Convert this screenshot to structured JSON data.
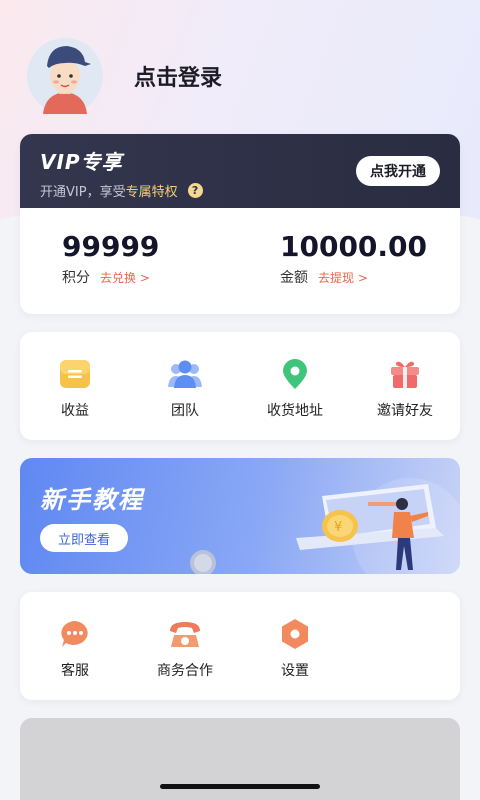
{
  "header": {
    "login_text": "点击登录"
  },
  "vip": {
    "title": "VIP专享",
    "subtitle_prefix": "开通VIP，享受",
    "subtitle_highlight": "专属特权",
    "help_icon": "?",
    "button": "点我开通"
  },
  "stats": [
    {
      "value": "99999",
      "label": "积分",
      "link": "去兑换 >"
    },
    {
      "value": "10000.00",
      "label": "金额",
      "link": "去提现 >"
    }
  ],
  "menu": [
    {
      "label": "收益",
      "icon": "income-icon"
    },
    {
      "label": "团队",
      "icon": "team-icon"
    },
    {
      "label": "收货地址",
      "icon": "location-pin-icon"
    },
    {
      "label": "邀请好友",
      "icon": "gift-icon"
    }
  ],
  "tutorial": {
    "title": "新手教程",
    "button": "立即查看"
  },
  "services": [
    {
      "label": "客服",
      "icon": "chat-bubble-icon"
    },
    {
      "label": "商务合作",
      "icon": "phone-icon"
    },
    {
      "label": "设置",
      "icon": "settings-hexagon-icon"
    }
  ],
  "colors": {
    "accent_orange": "#e9654a",
    "vip_dark": "#2f3147",
    "vip_gold": "#f3cf7a",
    "tutorial_blue": "#5f88f2"
  }
}
